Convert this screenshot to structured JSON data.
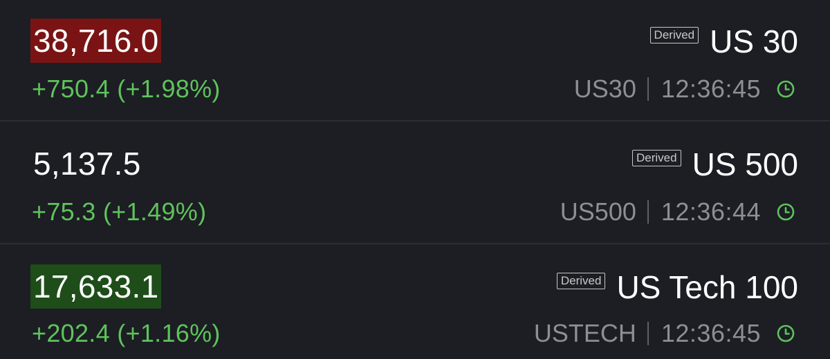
{
  "colors": {
    "background": "#1c1e24",
    "positive": "#5fc35b",
    "price_down_highlight": "#7a1414",
    "price_up_highlight": "#1e4d1a",
    "muted_text": "#8d8f95"
  },
  "instruments": [
    {
      "price": "38,716.0",
      "price_highlight": "down",
      "change": "+750.4 (+1.98%)",
      "badge": "Derived",
      "name": "US 30",
      "symbol": "US30",
      "separator": "|",
      "time": "12:36:45",
      "status_icon": "clock-icon"
    },
    {
      "price": "5,137.5",
      "price_highlight": "none",
      "change": "+75.3 (+1.49%)",
      "badge": "Derived",
      "name": "US 500",
      "symbol": "US500",
      "separator": "|",
      "time": "12:36:44",
      "status_icon": "clock-icon"
    },
    {
      "price": "17,633.1",
      "price_highlight": "up",
      "change": "+202.4 (+1.16%)",
      "badge": "Derived",
      "name": "US Tech 100",
      "symbol": "USTECH",
      "separator": "|",
      "time": "12:36:45",
      "status_icon": "clock-icon"
    }
  ]
}
